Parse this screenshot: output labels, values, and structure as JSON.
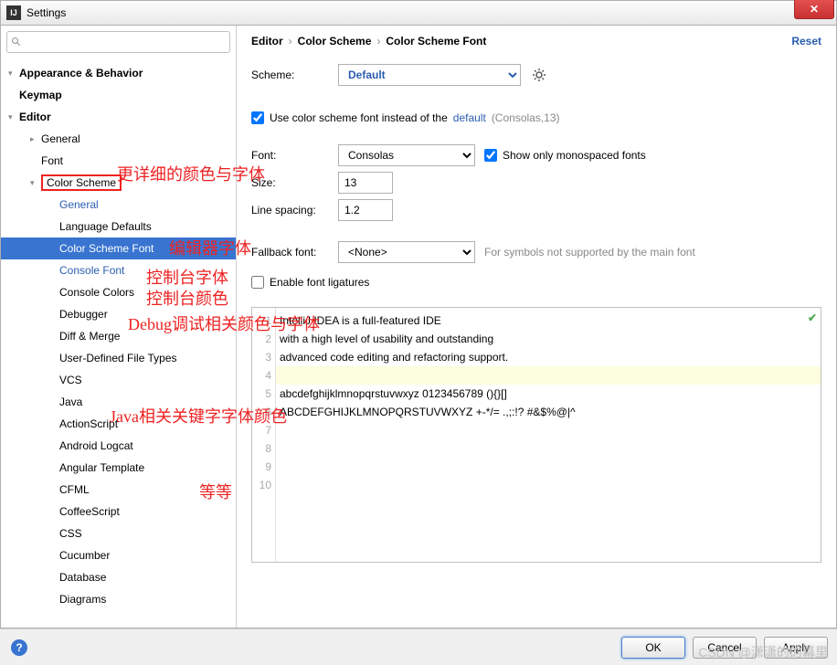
{
  "window": {
    "title": "Settings",
    "reset": "Reset"
  },
  "breadcrumb": [
    "Editor",
    "Color Scheme",
    "Color Scheme Font"
  ],
  "sidebar": {
    "items": [
      {
        "label": "Appearance & Behavior",
        "bold": true,
        "arrow": "v",
        "lvl": 0
      },
      {
        "label": "Keymap",
        "bold": true,
        "lvl": 0
      },
      {
        "label": "Editor",
        "bold": true,
        "arrow": "v",
        "lvl": 0
      },
      {
        "label": "General",
        "arrow": ">",
        "lvl": 1
      },
      {
        "label": "Font",
        "lvl": 1
      },
      {
        "label": "Color Scheme",
        "arrow": "v",
        "lvl": 1,
        "boxed": true
      },
      {
        "label": "General",
        "blue": true,
        "lvl": 2
      },
      {
        "label": "Language Defaults",
        "lvl": 2
      },
      {
        "label": "Color Scheme Font",
        "selected": true,
        "lvl": 2
      },
      {
        "label": "Console Font",
        "blue": true,
        "lvl": 2
      },
      {
        "label": "Console Colors",
        "lvl": 2
      },
      {
        "label": "Debugger",
        "lvl": 2
      },
      {
        "label": "Diff & Merge",
        "lvl": 2
      },
      {
        "label": "User-Defined File Types",
        "lvl": 2
      },
      {
        "label": "VCS",
        "lvl": 2
      },
      {
        "label": "Java",
        "lvl": 2
      },
      {
        "label": "ActionScript",
        "lvl": 2
      },
      {
        "label": "Android Logcat",
        "lvl": 2
      },
      {
        "label": "Angular Template",
        "lvl": 2
      },
      {
        "label": "CFML",
        "lvl": 2
      },
      {
        "label": "CoffeeScript",
        "lvl": 2
      },
      {
        "label": "CSS",
        "lvl": 2
      },
      {
        "label": "Cucumber",
        "lvl": 2
      },
      {
        "label": "Database",
        "lvl": 2
      },
      {
        "label": "Diagrams",
        "lvl": 2
      }
    ]
  },
  "form": {
    "scheme_label": "Scheme:",
    "scheme_value": "Default",
    "use_font_label": "Use color scheme font instead of the",
    "default_link": "default",
    "default_info": "(Consolas,13)",
    "font_label": "Font:",
    "font_value": "Consolas",
    "show_mono_label": "Show only monospaced fonts",
    "size_label": "Size:",
    "size_value": "13",
    "spacing_label": "Line spacing:",
    "spacing_value": "1.2",
    "fallback_label": "Fallback font:",
    "fallback_value": "<None>",
    "fallback_hint": "For symbols not supported by the main font",
    "ligatures_label": "Enable font ligatures"
  },
  "preview_lines": [
    "IntelliJ IDEA is a full-featured IDE",
    "with a high level of usability and outstanding",
    "advanced code editing and refactoring support.",
    "",
    "abcdefghijklmnopqrstuvwxyz 0123456789 (){}[]",
    "ABCDEFGHIJKLMNOPQRSTUVWXYZ +-*/= .,;:!? #&$%@|^",
    "",
    "",
    "",
    ""
  ],
  "buttons": {
    "ok": "OK",
    "cancel": "Cancel",
    "apply": "Apply"
  },
  "annot": {
    "a1": "更详细的颜色与字体",
    "a2": "编辑器字体",
    "a3": "控制台字体",
    "a4": "控制台颜色",
    "a5": "Debug调试相关颜色与字体",
    "a6": "Java相关关键字字体颜色",
    "a7": "等等"
  },
  "watermark": "CSDN @潇潇的的幕里"
}
